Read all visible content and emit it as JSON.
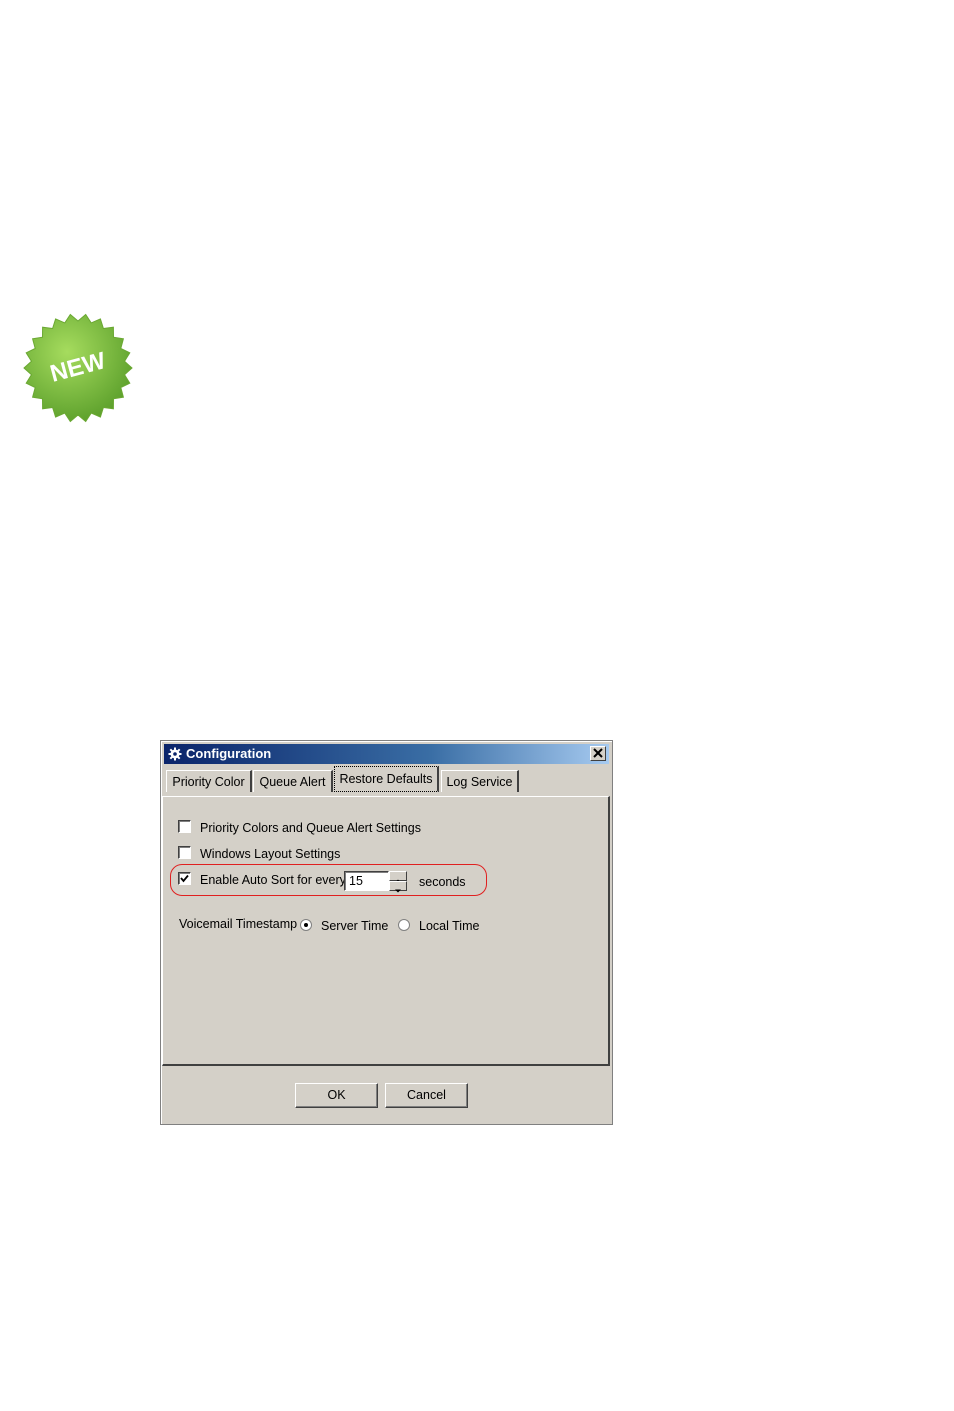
{
  "badge": {
    "text": "NEW",
    "color": "#7bbf3a"
  },
  "dialog": {
    "title": "Configuration",
    "icon": "gear-icon",
    "close_icon": "close-icon",
    "tabs": [
      {
        "label": "Priority Color"
      },
      {
        "label": "Queue Alert"
      },
      {
        "label": "Restore Defaults",
        "active": true
      },
      {
        "label": "Log Service"
      }
    ],
    "options": {
      "priority_colors": {
        "label": "Priority Colors and Queue Alert Settings",
        "checked": false
      },
      "windows_layout": {
        "label": "Windows Layout Settings",
        "checked": false
      },
      "auto_sort": {
        "label": "Enable Auto Sort for every",
        "checked": true,
        "value": "15",
        "unit": "seconds"
      }
    },
    "voicemail": {
      "label": "Voicemail Timestamp",
      "options": [
        {
          "label": "Server Time",
          "selected": true
        },
        {
          "label": "Local Time",
          "selected": false
        }
      ]
    },
    "buttons": {
      "ok": "OK",
      "cancel": "Cancel"
    },
    "highlight_color": "#e02020"
  }
}
